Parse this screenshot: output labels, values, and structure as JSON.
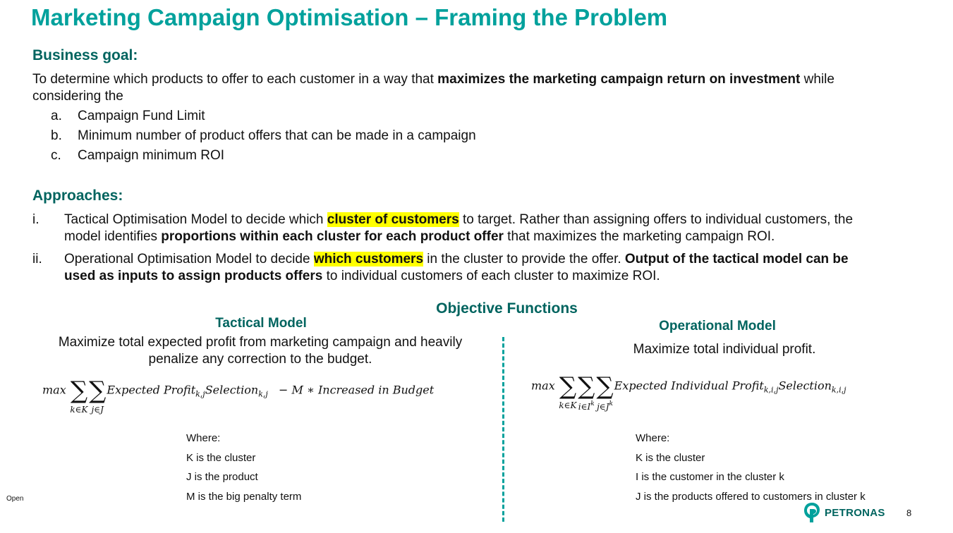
{
  "title": "Marketing Campaign Optimisation – Framing the Problem",
  "business_goal": {
    "heading": "Business goal:",
    "text_pre": "To determine which products to offer to each customer in a way that ",
    "text_bold": "maximizes the marketing campaign return on investment",
    "text_post": " while",
    "text_line2": "considering the",
    "items": [
      {
        "marker": "a.",
        "text": "Campaign Fund Limit"
      },
      {
        "marker": "b.",
        "text": "Minimum number of product offers that can be made in a campaign"
      },
      {
        "marker": "c.",
        "text": "Campaign minimum ROI"
      }
    ]
  },
  "approaches": {
    "heading": "Approaches:",
    "items": [
      {
        "marker": "i.",
        "p1": "Tactical Optimisation Model to decide which ",
        "highlight": "cluster of customers",
        "p2": " to target. Rather than assigning offers to individual customers, the",
        "line2_pre": "model identifies ",
        "line2_bold": "proportions within each cluster for each product offer",
        "line2_post": " that maximizes the marketing campaign ROI."
      },
      {
        "marker": "ii.",
        "p1": "Operational Optimisation Model to decide ",
        "highlight": "which customers",
        "p2": " in the cluster to provide the offer. ",
        "p2_bold": "Output of the tactical model can be",
        "line2_bold": "used as inputs to assign products offers",
        "line2_post": " to individual customers of each cluster to maximize ROI."
      }
    ]
  },
  "objective": {
    "heading": "Objective Functions",
    "tactical": {
      "title": "Tactical Model",
      "desc_line1": "Maximize total expected profit from marketing campaign and heavily",
      "desc_line2": "penalize any correction to the budget.",
      "formula": {
        "max": "max",
        "sum1": "k∈K",
        "sum2": "j∈J",
        "term": "Expected Profit",
        "term_sub": "k,j",
        "sel": "Selection",
        "sel_sub": "k,j",
        "penalty": " − M ∗ Increased in Budget"
      },
      "where": [
        "Where:",
        "K is the cluster",
        "J is the product",
        "M is the big penalty term"
      ]
    },
    "operational": {
      "title": "Operational Model",
      "desc": "Maximize total individual profit.",
      "formula": {
        "max": "max",
        "sum1": "k∈K",
        "sum2": "i∈I",
        "sum2_sup": "k",
        "sum3": "j∈J",
        "sum3_sup": "k",
        "term": "Expected Individual Profit",
        "term_sub": "k,i,j",
        "sel": "Selection",
        "sel_sub": "k,i,j"
      },
      "where": [
        "Where:",
        "K is the cluster",
        "I is the customer in the cluster k",
        "J is the products offered to customers in cluster k"
      ]
    }
  },
  "footer": {
    "classification": "Open",
    "logo_text": "PETRONAS",
    "page": "8"
  },
  "colors": {
    "title": "#00a19c",
    "heading": "#00645f",
    "highlight": "#ffff00"
  }
}
